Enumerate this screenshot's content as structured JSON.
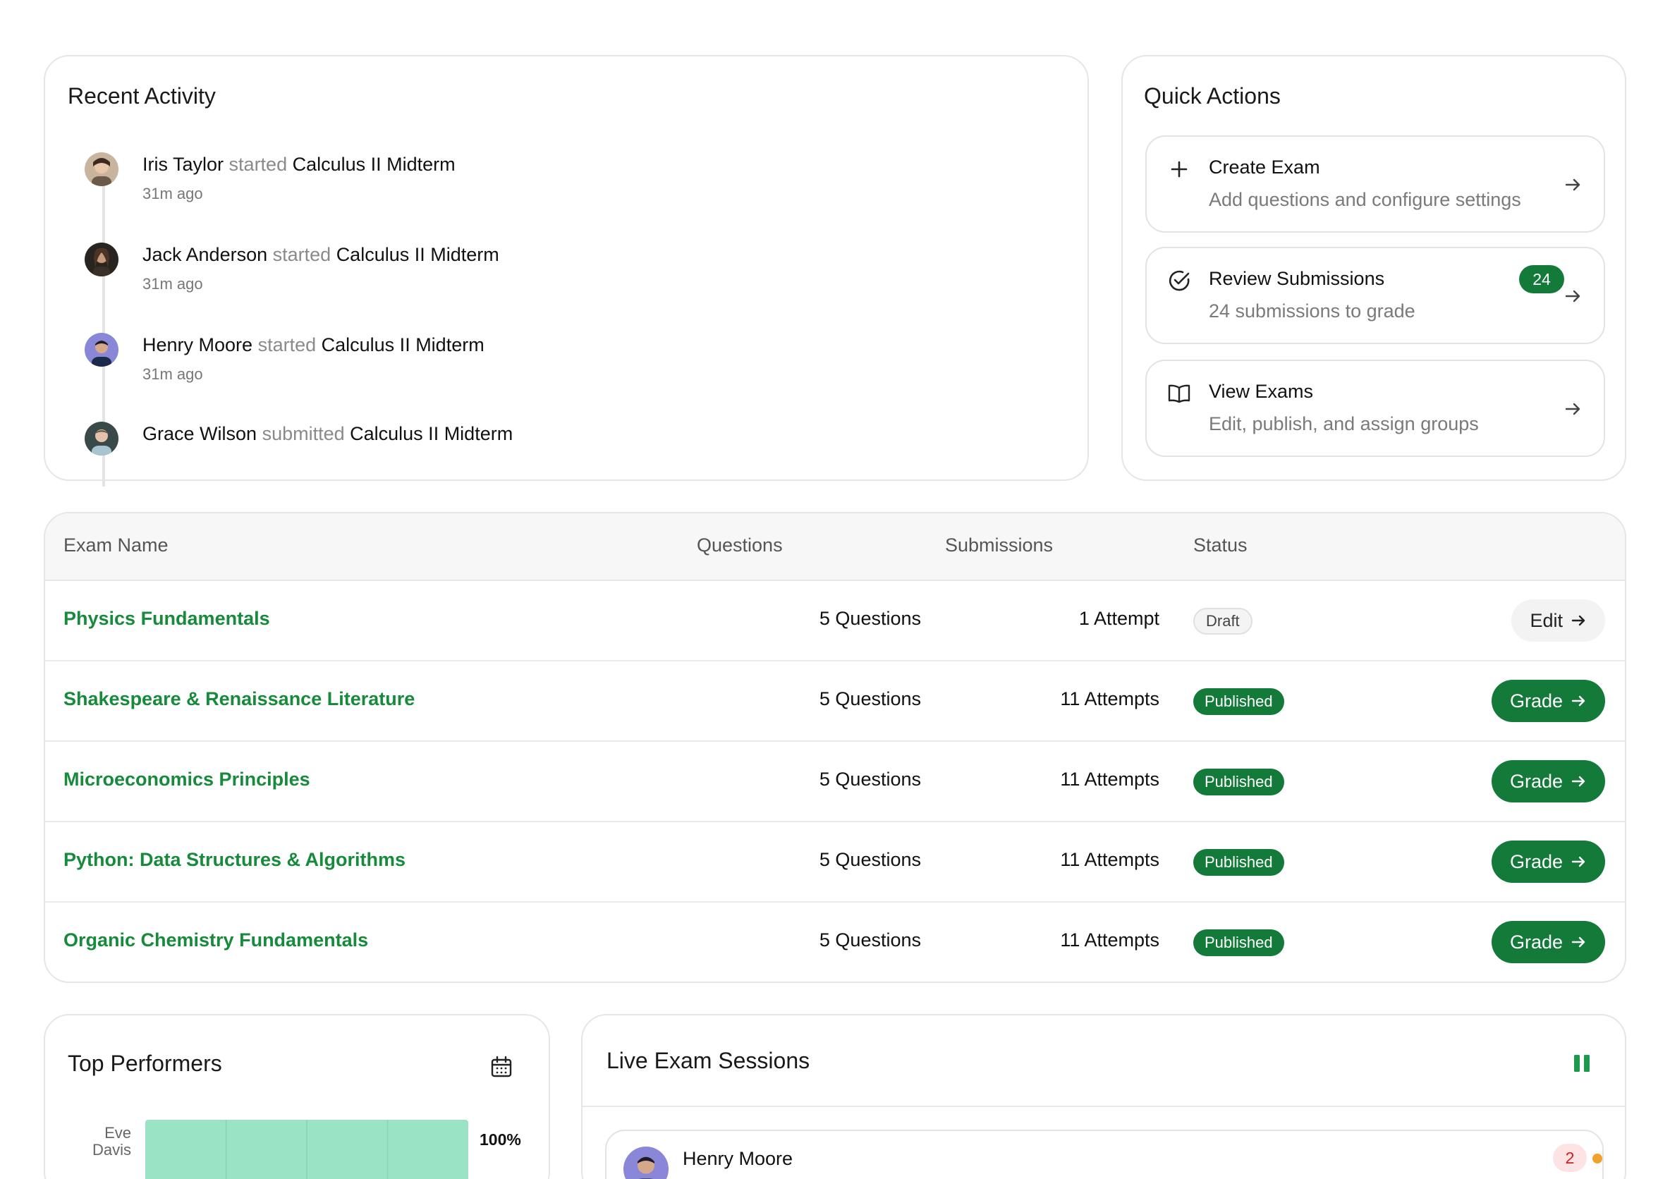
{
  "recent_activity": {
    "title": "Recent Activity",
    "items": [
      {
        "name": "Iris Taylor",
        "verb": "started",
        "exam": "Calculus II Midterm",
        "time": "31m ago"
      },
      {
        "name": "Jack Anderson",
        "verb": "started",
        "exam": "Calculus II Midterm",
        "time": "31m ago"
      },
      {
        "name": "Henry Moore",
        "verb": "started",
        "exam": "Calculus II Midterm",
        "time": "31m ago"
      },
      {
        "name": "Grace Wilson",
        "verb": "submitted",
        "exam": "Calculus II Midterm",
        "time": ""
      }
    ]
  },
  "quick_actions": {
    "title": "Quick Actions",
    "items": [
      {
        "icon": "plus-icon",
        "title": "Create Exam",
        "subtitle": "Add questions and configure settings"
      },
      {
        "icon": "check-circle-icon",
        "title": "Review Submissions",
        "subtitle": "24 submissions to grade",
        "badge": "24"
      },
      {
        "icon": "book-open-icon",
        "title": "View Exams",
        "subtitle": "Edit, publish, and assign groups"
      }
    ]
  },
  "exams_table": {
    "headers": {
      "name": "Exam Name",
      "questions": "Questions",
      "submissions": "Submissions",
      "status": "Status"
    },
    "rows": [
      {
        "name": "Physics Fundamentals",
        "questions": "5 Questions",
        "submissions": "1 Attempt",
        "status": "Draft",
        "action": "Edit"
      },
      {
        "name": "Shakespeare & Renaissance Literature",
        "questions": "5 Questions",
        "submissions": "11 Attempts",
        "status": "Published",
        "action": "Grade"
      },
      {
        "name": "Microeconomics Principles",
        "questions": "5 Questions",
        "submissions": "11 Attempts",
        "status": "Published",
        "action": "Grade"
      },
      {
        "name": "Python: Data Structures & Algorithms",
        "questions": "5 Questions",
        "submissions": "11 Attempts",
        "status": "Published",
        "action": "Grade"
      },
      {
        "name": "Organic Chemistry Fundamentals",
        "questions": "5 Questions",
        "submissions": "11 Attempts",
        "status": "Published",
        "action": "Grade"
      }
    ]
  },
  "top_performers": {
    "title": "Top Performers",
    "icon": "calendar-icon",
    "chart_data": {
      "type": "bar",
      "orientation": "horizontal",
      "categories": [
        "Eve Davis"
      ],
      "values": [
        100
      ],
      "value_labels": [
        "100%"
      ],
      "xlim": [
        0,
        100
      ],
      "grid": true,
      "bar_color": "#9ae3c5"
    }
  },
  "live_sessions": {
    "title": "Live Exam Sessions",
    "pause_icon": "pause-icon",
    "sessions": [
      {
        "name": "Henry Moore",
        "count": "2",
        "status_color": "#f2a12e"
      }
    ]
  },
  "colors": {
    "accent": "#137a3a",
    "link": "#178a3c",
    "border": "#e6e6e6"
  }
}
